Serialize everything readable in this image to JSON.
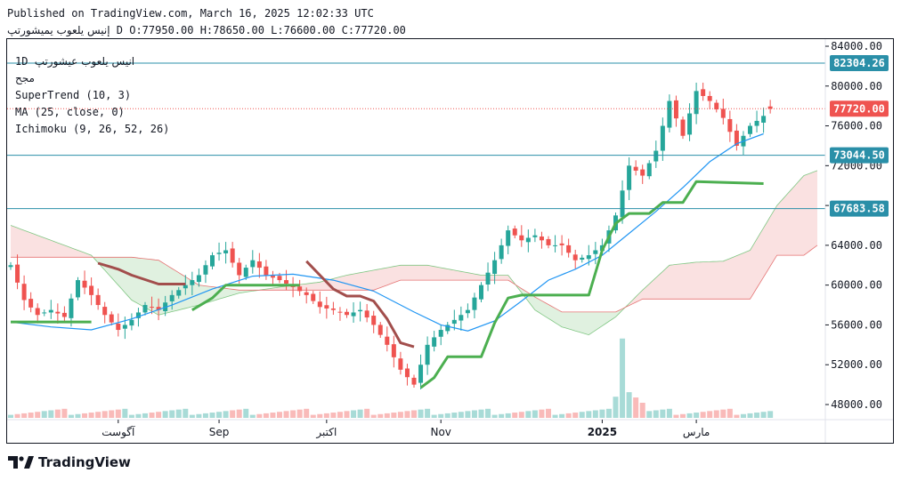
{
  "header": {
    "published": "Published on TradingView.com, March 16, 2025 12:02:33 UTC",
    "symbol": "إنيس يلعوب يميشورتپ",
    "ohlc": "D O:77950.00 H:78650.00 L:76600.00 C:77720.00"
  },
  "legend": {
    "line1_interval": "1D",
    "line1_name": "انيس يلعوب عيشورتپ",
    "line2": "مجح",
    "supertrend": "SuperTrend (10, 3)",
    "ma": "MA (25, close, 0)",
    "ichimoku": "Ichimoku (9, 26, 52, 26)"
  },
  "logo": {
    "text": "TradingView",
    "icon": "tradingview-logo-icon"
  },
  "colors": {
    "up": "#26a69a",
    "down": "#ef5350",
    "supertrend_up": "#4caf50",
    "supertrend_down": "#a24e4c",
    "ma": "#2196f3",
    "cloud_green": "#a5d6a7",
    "cloud_red": "#ef9a9a",
    "hline": "#2a8fa8"
  },
  "chart_data": {
    "type": "candlestick",
    "title": "",
    "ylim": [
      46500,
      85000
    ],
    "yticks": [
      48000,
      52000,
      56000,
      60000,
      64000,
      68000,
      72000,
      76000,
      80000,
      84000
    ],
    "ytick_labels": [
      "48000.00",
      "52000.00",
      "56000.00",
      "60000.00",
      "64000.00",
      "68000.00",
      "72000.00",
      "76000.00",
      "80000.00",
      "84000.00"
    ],
    "xticks": [
      {
        "label": "آگوست",
        "i": 16
      },
      {
        "label": "Sep",
        "i": 31
      },
      {
        "label": "اکتبر",
        "i": 47
      },
      {
        "label": "Nov",
        "i": 64
      },
      {
        "label": "2025",
        "i": 88,
        "bold": true
      },
      {
        "label": "مارس",
        "i": 102
      }
    ],
    "price_labels": [
      {
        "value": 82304.26,
        "text": "82304.26",
        "kind": "hline"
      },
      {
        "value": 77720.0,
        "text": "77720.00",
        "kind": "last"
      },
      {
        "value": 73044.5,
        "text": "73044.50",
        "kind": "hline"
      },
      {
        "value": 67683.58,
        "text": "67683.58",
        "kind": "hline"
      }
    ],
    "last_price": 77720.0,
    "x_first": 0,
    "x_last": 113,
    "close": [
      [
        0,
        62000
      ],
      [
        2,
        58500
      ],
      [
        4,
        57000
      ],
      [
        6,
        57500
      ],
      [
        8,
        56800
      ],
      [
        10,
        60500
      ],
      [
        12,
        59000
      ],
      [
        14,
        57000
      ],
      [
        16,
        55500
      ],
      [
        18,
        56500
      ],
      [
        20,
        58000
      ],
      [
        22,
        57500
      ],
      [
        24,
        59000
      ],
      [
        26,
        60000
      ],
      [
        28,
        61000
      ],
      [
        30,
        63000
      ],
      [
        32,
        63500
      ],
      [
        34,
        61000
      ],
      [
        36,
        62500
      ],
      [
        38,
        61000
      ],
      [
        40,
        60500
      ],
      [
        42,
        59800
      ],
      [
        44,
        59000
      ],
      [
        46,
        57800
      ],
      [
        48,
        57500
      ],
      [
        50,
        57000
      ],
      [
        52,
        57500
      ],
      [
        54,
        56000
      ],
      [
        56,
        54000
      ],
      [
        58,
        51500
      ],
      [
        60,
        50000
      ],
      [
        62,
        54000
      ],
      [
        64,
        55500
      ],
      [
        66,
        56500
      ],
      [
        68,
        57500
      ],
      [
        70,
        60000
      ],
      [
        72,
        62500
      ],
      [
        74,
        65500
      ],
      [
        76,
        64500
      ],
      [
        78,
        65000
      ],
      [
        80,
        64000
      ],
      [
        82,
        64000
      ],
      [
        84,
        62500
      ],
      [
        86,
        63000
      ],
      [
        88,
        64000
      ],
      [
        90,
        67000
      ],
      [
        92,
        72000
      ],
      [
        94,
        71000
      ],
      [
        96,
        73500
      ],
      [
        98,
        78500
      ],
      [
        100,
        75000
      ],
      [
        102,
        79500
      ],
      [
        104,
        78500
      ],
      [
        106,
        76800
      ],
      [
        108,
        74000
      ],
      [
        110,
        76000
      ],
      [
        112,
        77000
      ],
      [
        113,
        77720
      ]
    ],
    "series": [
      {
        "name": "MA (25, close, 0)",
        "points": [
          [
            0,
            56300
          ],
          [
            6,
            55800
          ],
          [
            12,
            55500
          ],
          [
            18,
            56600
          ],
          [
            24,
            58000
          ],
          [
            30,
            59600
          ],
          [
            36,
            60900
          ],
          [
            42,
            61100
          ],
          [
            48,
            60500
          ],
          [
            54,
            59400
          ],
          [
            60,
            57300
          ],
          [
            64,
            56000
          ],
          [
            68,
            55400
          ],
          [
            72,
            56400
          ],
          [
            76,
            58400
          ],
          [
            80,
            60500
          ],
          [
            84,
            61600
          ],
          [
            88,
            63000
          ],
          [
            92,
            65200
          ],
          [
            96,
            67400
          ],
          [
            100,
            69800
          ],
          [
            104,
            72400
          ],
          [
            108,
            74200
          ],
          [
            112,
            75200
          ]
        ]
      },
      {
        "name": "SuperTrend (10, 3)",
        "points": [
          [
            0,
            56300
          ],
          [
            12,
            56300
          ],
          [
            13,
            62200
          ],
          [
            16,
            61600
          ],
          [
            18,
            61000
          ],
          [
            22,
            60100
          ],
          [
            26,
            60100
          ],
          [
            27,
            57500
          ],
          [
            30,
            58700
          ],
          [
            32,
            60000
          ],
          [
            36,
            60000
          ],
          [
            41,
            60000
          ],
          [
            43,
            60000
          ],
          [
            44,
            62400
          ],
          [
            46,
            61000
          ],
          [
            48,
            59600
          ],
          [
            50,
            58900
          ],
          [
            52,
            58900
          ],
          [
            54,
            58400
          ],
          [
            56,
            56600
          ],
          [
            58,
            54200
          ],
          [
            60,
            53800
          ],
          [
            61,
            49700
          ],
          [
            63,
            50700
          ],
          [
            65,
            52800
          ],
          [
            70,
            52800
          ],
          [
            72,
            56200
          ],
          [
            74,
            58700
          ],
          [
            76,
            59000
          ],
          [
            80,
            59000
          ],
          [
            86,
            59000
          ],
          [
            88,
            63500
          ],
          [
            90,
            66200
          ],
          [
            92,
            67200
          ],
          [
            95,
            67200
          ],
          [
            97,
            68300
          ],
          [
            100,
            68300
          ],
          [
            102,
            70400
          ],
          [
            112,
            70200
          ]
        ],
        "trend": [
          {
            "from": 0,
            "to": 12,
            "dir": "up"
          },
          {
            "from": 13,
            "to": 26,
            "dir": "down"
          },
          {
            "from": 27,
            "to": 43,
            "dir": "up"
          },
          {
            "from": 44,
            "to": 60,
            "dir": "down"
          },
          {
            "from": 61,
            "to": 112,
            "dir": "up"
          }
        ]
      },
      {
        "name": "Ichimoku Leading Span A",
        "points": [
          [
            0,
            66000
          ],
          [
            6,
            64500
          ],
          [
            12,
            63000
          ],
          [
            18,
            58500
          ],
          [
            22,
            57000
          ],
          [
            28,
            58000
          ],
          [
            34,
            59200
          ],
          [
            40,
            59800
          ],
          [
            46,
            60300
          ],
          [
            50,
            61000
          ],
          [
            54,
            61500
          ],
          [
            58,
            62000
          ],
          [
            62,
            62000
          ],
          [
            66,
            61500
          ],
          [
            70,
            61000
          ],
          [
            74,
            61000
          ],
          [
            78,
            57500
          ],
          [
            82,
            55800
          ],
          [
            86,
            55000
          ],
          [
            90,
            56800
          ],
          [
            94,
            59500
          ],
          [
            98,
            62000
          ],
          [
            102,
            62300
          ],
          [
            106,
            62400
          ],
          [
            110,
            63500
          ],
          [
            114,
            68000
          ],
          [
            118,
            71000
          ],
          [
            120,
            71500
          ]
        ]
      },
      {
        "name": "Ichimoku Leading Span B",
        "points": [
          [
            0,
            62800
          ],
          [
            6,
            62800
          ],
          [
            12,
            62800
          ],
          [
            18,
            62800
          ],
          [
            22,
            62500
          ],
          [
            28,
            60000
          ],
          [
            34,
            59500
          ],
          [
            40,
            59500
          ],
          [
            46,
            59500
          ],
          [
            50,
            59500
          ],
          [
            54,
            59500
          ],
          [
            58,
            60500
          ],
          [
            62,
            60500
          ],
          [
            66,
            60500
          ],
          [
            70,
            60500
          ],
          [
            74,
            60500
          ],
          [
            78,
            58800
          ],
          [
            82,
            57300
          ],
          [
            86,
            57300
          ],
          [
            90,
            57300
          ],
          [
            94,
            58600
          ],
          [
            98,
            58600
          ],
          [
            102,
            58600
          ],
          [
            106,
            58600
          ],
          [
            110,
            58600
          ],
          [
            114,
            63000
          ],
          [
            118,
            63000
          ],
          [
            120,
            64000
          ]
        ]
      }
    ]
  }
}
